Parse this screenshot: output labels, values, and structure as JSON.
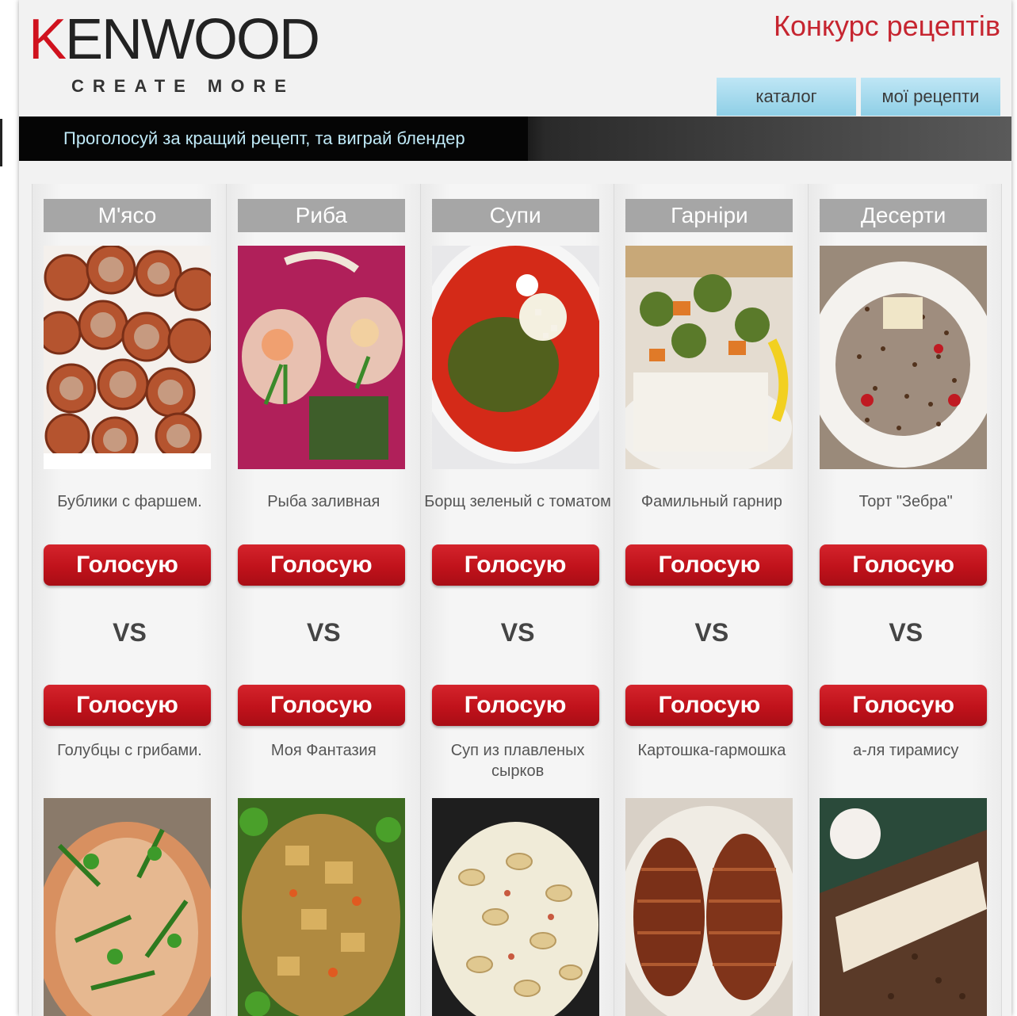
{
  "header": {
    "logo_text_k": "K",
    "logo_text_rest": "ENWOOD",
    "logo_tagline": "CREATE MORE",
    "contest_title": "Конкурс рецептів",
    "nav": {
      "catalog": "каталог",
      "my_recipes": "мої рецепти"
    },
    "banner": "Проголосуй за кращий рецепт, та виграй блендер"
  },
  "vote_label": "Голосую",
  "vs_label": "VS",
  "colors": {
    "brand_red": "#c0121b",
    "title_red": "#c62530",
    "nav_blue": "#9fd6ea",
    "banner_text": "#bfe9f7"
  },
  "columns": [
    {
      "category": "М'ясо",
      "top": {
        "name": "Бублики с фаршем.",
        "photo": "meat-rings-photo"
      },
      "bottom": {
        "name": "Голубцы с грибами.",
        "photo": "cabbage-rolls-photo"
      }
    },
    {
      "category": "Риба",
      "top": {
        "name": "Рыба заливная",
        "photo": "fish-aspic-photo"
      },
      "bottom": {
        "name": "Моя Фантазия",
        "photo": "fantasy-dish-photo"
      }
    },
    {
      "category": "Супи",
      "top": {
        "name": "Борщ зеленый с томатом",
        "photo": "borscht-photo"
      },
      "bottom": {
        "name": "Суп из плавленых сырков",
        "photo": "cheese-soup-photo"
      }
    },
    {
      "category": "Гарніри",
      "top": {
        "name": "Фамильный гарнир",
        "photo": "family-garnish-photo"
      },
      "bottom": {
        "name": "Картошка-гармошка",
        "photo": "accordion-potato-photo"
      }
    },
    {
      "category": "Десерти",
      "top": {
        "name": "Торт \"Зебра\"",
        "photo": "zebra-cake-photo"
      },
      "bottom": {
        "name": "а-ля тирамису",
        "photo": "tiramisu-photo"
      }
    }
  ]
}
